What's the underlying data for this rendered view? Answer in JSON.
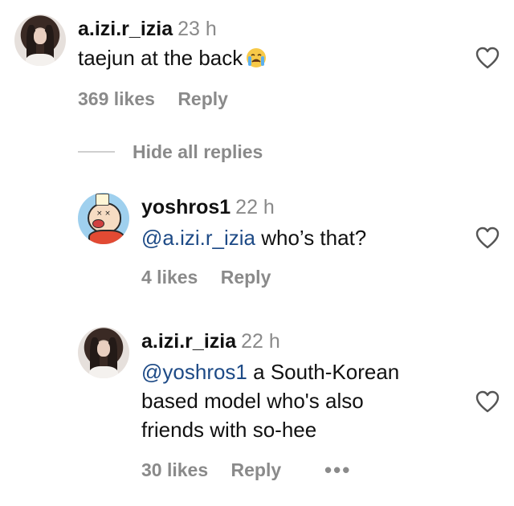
{
  "comments": [
    {
      "username": "a.izi.r_izia",
      "time": "23 h",
      "text": "taejun at the back",
      "emoji": "crying-face-icon",
      "likes": "369 likes",
      "reply": "Reply"
    },
    {
      "username": "yoshros1",
      "time": "22 h",
      "mention": "@a.izi.r_izia",
      "text": " who’s that?",
      "likes": "4 likes",
      "reply": "Reply"
    },
    {
      "username": "a.izi.r_izia",
      "time": "22 h",
      "mention": "@yoshros1",
      "text_line1": " a South-Korean",
      "text_line2": "based model who's also",
      "text_line3": "friends with so-hee",
      "likes": "30 likes",
      "reply": "Reply",
      "more": "•••"
    }
  ],
  "replies_toggle": "Hide all replies",
  "colors": {
    "mention": "#1d4a86",
    "secondary_text": "#8a8a8a",
    "primary_text": "#111111"
  }
}
